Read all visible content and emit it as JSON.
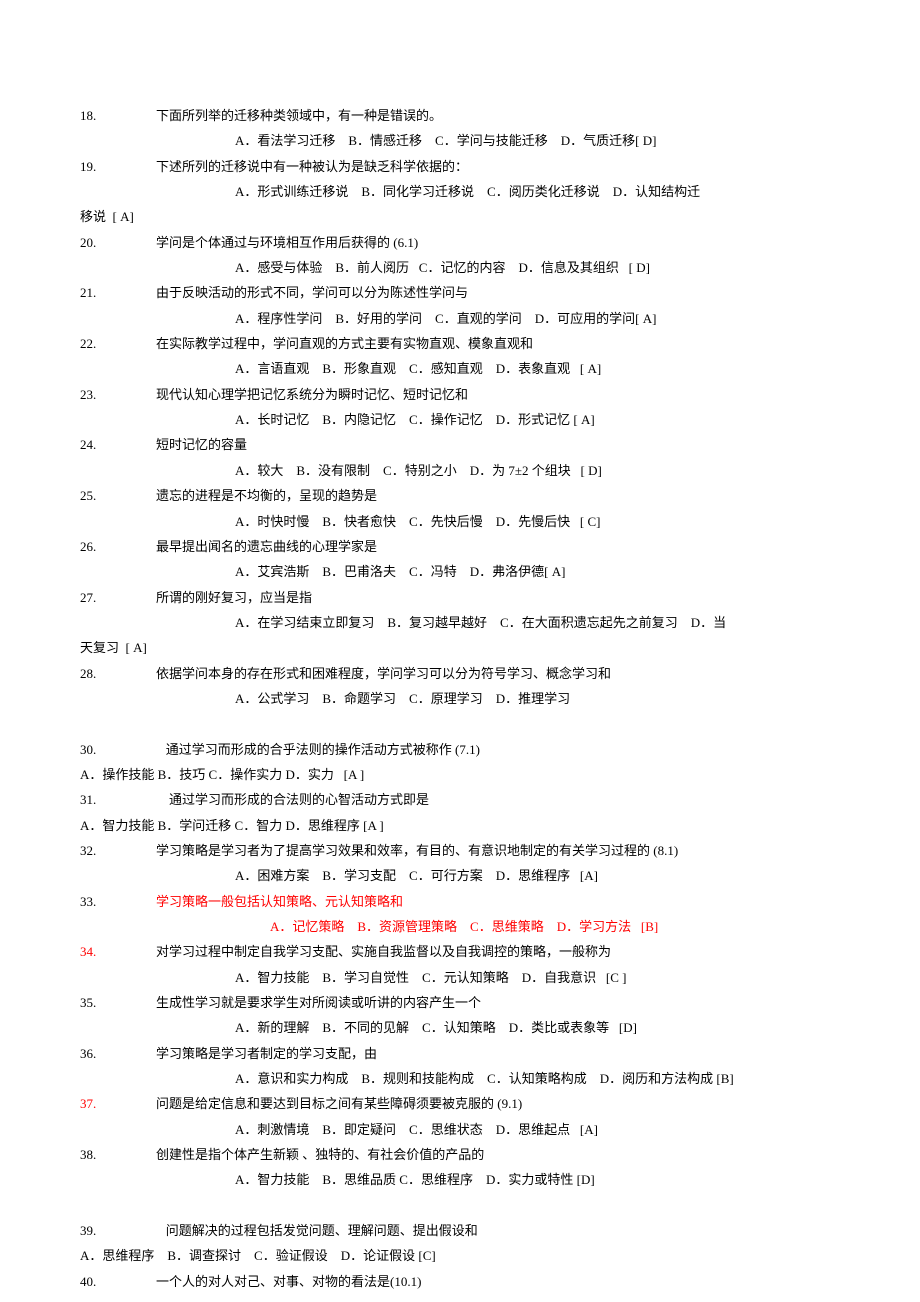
{
  "questions": [
    {
      "num": "18.",
      "text": "下面所列举的迁移种类领域中，有一种是错误的。",
      "opts": "A．看法学习迁移    B．情感迁移    C．学问与技能迁移    D．气质迁移[ D]",
      "indent": "wide"
    },
    {
      "num": "19.",
      "text": "下述所列的迁移说中有一种被认为是缺乏科学依据的：",
      "opts": "A．形式训练迁移说    B．同化学习迁移说    C．阅历类化迁移说    D．认知结构迁",
      "indent": "wide",
      "continuation": "移说  [ A]"
    },
    {
      "num": "20.",
      "text": "学问是个体通过与环境相互作用后获得的 (6.1)",
      "opts": "A．感受与体验    B．前人阅历   C．记忆的内容    D．信息及其组织   [ D]",
      "indent": "wide"
    },
    {
      "num": "21.",
      "text": "由于反映活动的形式不同，学问可以分为陈述性学问与",
      "opts": "A．程序性学问    B．好用的学问    C．直观的学问    D．可应用的学问[ A]",
      "indent": "wide"
    },
    {
      "num": "22.",
      "text": "在实际教学过程中，学问直观的方式主要有实物直观、模象直观和",
      "opts": "A．言语直观    B．形象直观    C．感知直观    D．表象直观   [ A]",
      "indent": "wide"
    },
    {
      "num": "23.",
      "text": "现代认知心理学把记忆系统分为瞬时记忆、短时记忆和",
      "opts": "A．长时记忆    B．内隐记忆    C．操作记忆    D．形式记忆 [ A]",
      "indent": "wide"
    },
    {
      "num": "24.",
      "text": "短时记忆的容量",
      "opts": "A．较大    B．没有限制    C．特别之小    D．为 7±2 个组块   [ D]",
      "indent": "wide"
    },
    {
      "num": "25.",
      "text": "遗忘的进程是不均衡的，呈现的趋势是",
      "opts": "A．时快时慢    B．快者愈快    C．先快后慢    D．先慢后快   [ C]",
      "indent": "wide"
    },
    {
      "num": "26.",
      "text": "最早提出闻名的遗忘曲线的心理学家是",
      "opts": "A．艾宾浩斯    B．巴甫洛夫    C．冯特    D．弗洛伊德[ A]",
      "indent": "wide"
    },
    {
      "num": "27.",
      "text": "所谓的刚好复习，应当是指",
      "opts": "A．在学习结束立即复习    B．复习越早越好    C．在大面积遗忘起先之前复习    D．当",
      "indent": "wide",
      "continuation": "天复习  [ A]"
    },
    {
      "num": "28.",
      "text": "依据学问本身的存在形式和困难程度，学问学习可以分为符号学习、概念学习和",
      "opts": "A．公式学习    B．命题学习    C．原理学习    D．推理学习",
      "indent": "wide",
      "gap_after": true
    },
    {
      "num": "30.",
      "text": "   通过学习而形成的合乎法则的操作活动方式被称作 (7.1)",
      "opts": "A．操作技能 B．技巧 C．操作实力 D．实力   [A ]",
      "indent": "none"
    },
    {
      "num": "31.",
      "text": "    通过学习而形成的合法则的心智活动方式即是",
      "opts": "A．智力技能 B．学问迁移 C．智力 D．思维程序 [A ]",
      "indent": "none"
    },
    {
      "num": "32.",
      "text": "学习策略是学习者为了提高学习效果和效率，有目的、有意识地制定的有关学习过程的 (8.1)",
      "opts": "A．困难方案    B．学习支配    C．可行方案    D．思维程序   [A]",
      "indent": "wide"
    },
    {
      "num": "33.",
      "text": "学习策略一般包括认知策略、元认知策略和",
      "opts": "A．记忆策略    B．资源管理策略    C．思维策略    D．学习方法   [B]",
      "indent": "wide2",
      "text_red": true,
      "opts_red": true
    },
    {
      "num": "34.",
      "text": "对学习过程中制定自我学习支配、实施自我监督以及自我调控的策略，一般称为",
      "opts": "A．智力技能    B．学习自觉性    C．元认知策略    D．自我意识   [C ]",
      "indent": "wide",
      "num_red": true
    },
    {
      "num": "35.",
      "text": "生成性学习就是要求学生对所阅读或听讲的内容产生一个",
      "opts": "A．新的理解    B．不同的见解    C．认知策略    D．类比或表象等   [D]",
      "indent": "wide"
    },
    {
      "num": "36.",
      "text": "学习策略是学习者制定的学习支配，由",
      "opts": "A．意识和实力构成    B．规则和技能构成    C．认知策略构成    D．阅历和方法构成 [B]",
      "indent": "wide"
    },
    {
      "num": "37.",
      "text": "问题是给定信息和要达到目标之间有某些障碍须要被克服的 (9.1)",
      "opts": "A．刺激情境    B．即定疑问    C．思维状态    D．思维起点   [A]",
      "indent": "wide",
      "num_red": true
    },
    {
      "num": "38.",
      "text": "创建性是指个体产生新颖 、独特的、有社会价值的产品的",
      "opts": "A．智力技能    B．思维品质 C．思维程序    D．实力或特性 [D]",
      "indent": "wide",
      "gap_after": true
    },
    {
      "num": "39.",
      "text": "   问题解决的过程包括发觉问题、理解问题、提出假设和",
      "opts": "A．思维程序    B．调查探讨    C．验证假设    D．论证假设 [C]",
      "indent": "none"
    },
    {
      "num": "40.",
      "text": "一个人的对人对己、对事、对物的看法是(10.1)"
    }
  ]
}
